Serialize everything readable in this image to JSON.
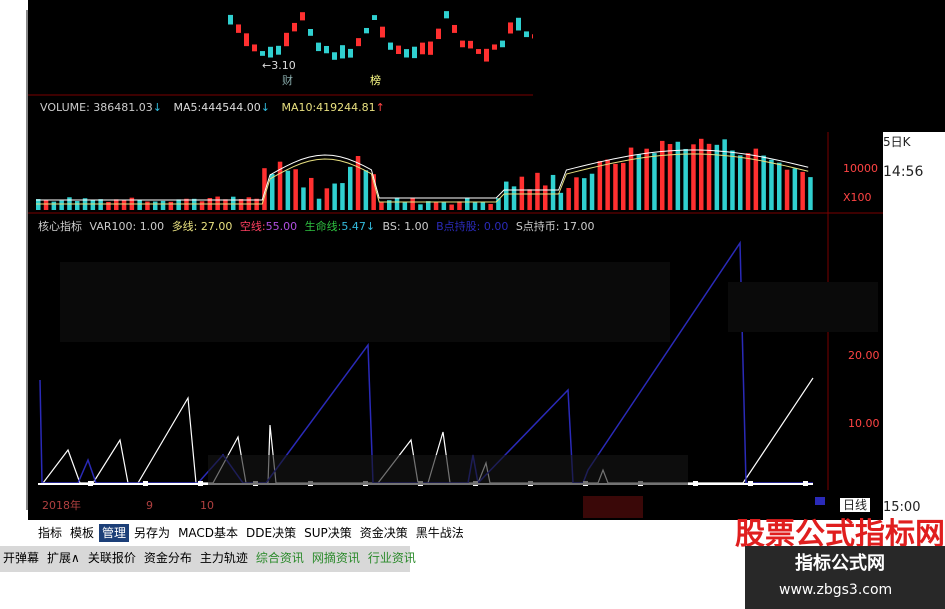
{
  "kline": {
    "low_label": "←3.10",
    "events": [
      "财",
      "榜"
    ]
  },
  "volume": {
    "label": "VOLUME:",
    "value": "386481.03",
    "value_arrow": "↓",
    "ma5_label": "MA5:",
    "ma5": "444544.00",
    "ma5_arrow": "↓",
    "ma10_label": "MA10:",
    "ma10": "419244.81",
    "ma10_arrow": "↑",
    "axis": "10000",
    "unit": "X100"
  },
  "indicator": {
    "title": "核心指标",
    "var100": "VAR100: 1.00",
    "duo": "多线: 27.00",
    "kong_label": "空线:",
    "kong": "55.00",
    "sml_label": "生命线:",
    "sml": "5.47",
    "bs": "BS: 1.00",
    "hidden": "B点持股: 0.00",
    "s": "S点持币: 17.00",
    "axis": [
      "20.00",
      "10.00"
    ]
  },
  "right_panel": {
    "tag": "5日K",
    "time": "14:56"
  },
  "bottom": {
    "year": "2018年",
    "m1": "9",
    "m2": "10",
    "period": "日线",
    "time": "15:00"
  },
  "tabs1": [
    "指标",
    "模板",
    "管理",
    "另存为",
    "MACD基本",
    "DDE决策",
    "SUP决策",
    "资金决策",
    "黑牛战法"
  ],
  "tabs1_selected": 2,
  "tabs2": [
    "开弹幕",
    "扩展∧",
    "关联报价",
    "资金分布",
    "主力轨迹",
    "综合资讯",
    "网摘资讯",
    "行业资讯"
  ],
  "watermark": {
    "big": "股票公式指标网",
    "title": "指标公式网",
    "url": "www.zbgs3.com"
  },
  "colors": {
    "bg": "#000000",
    "grid": "#7a0000",
    "up": "#ff3030",
    "down": "#30d0d0",
    "blue": "#2a2ab8",
    "white": "#ffffff",
    "yellow": "#e8e080"
  }
}
